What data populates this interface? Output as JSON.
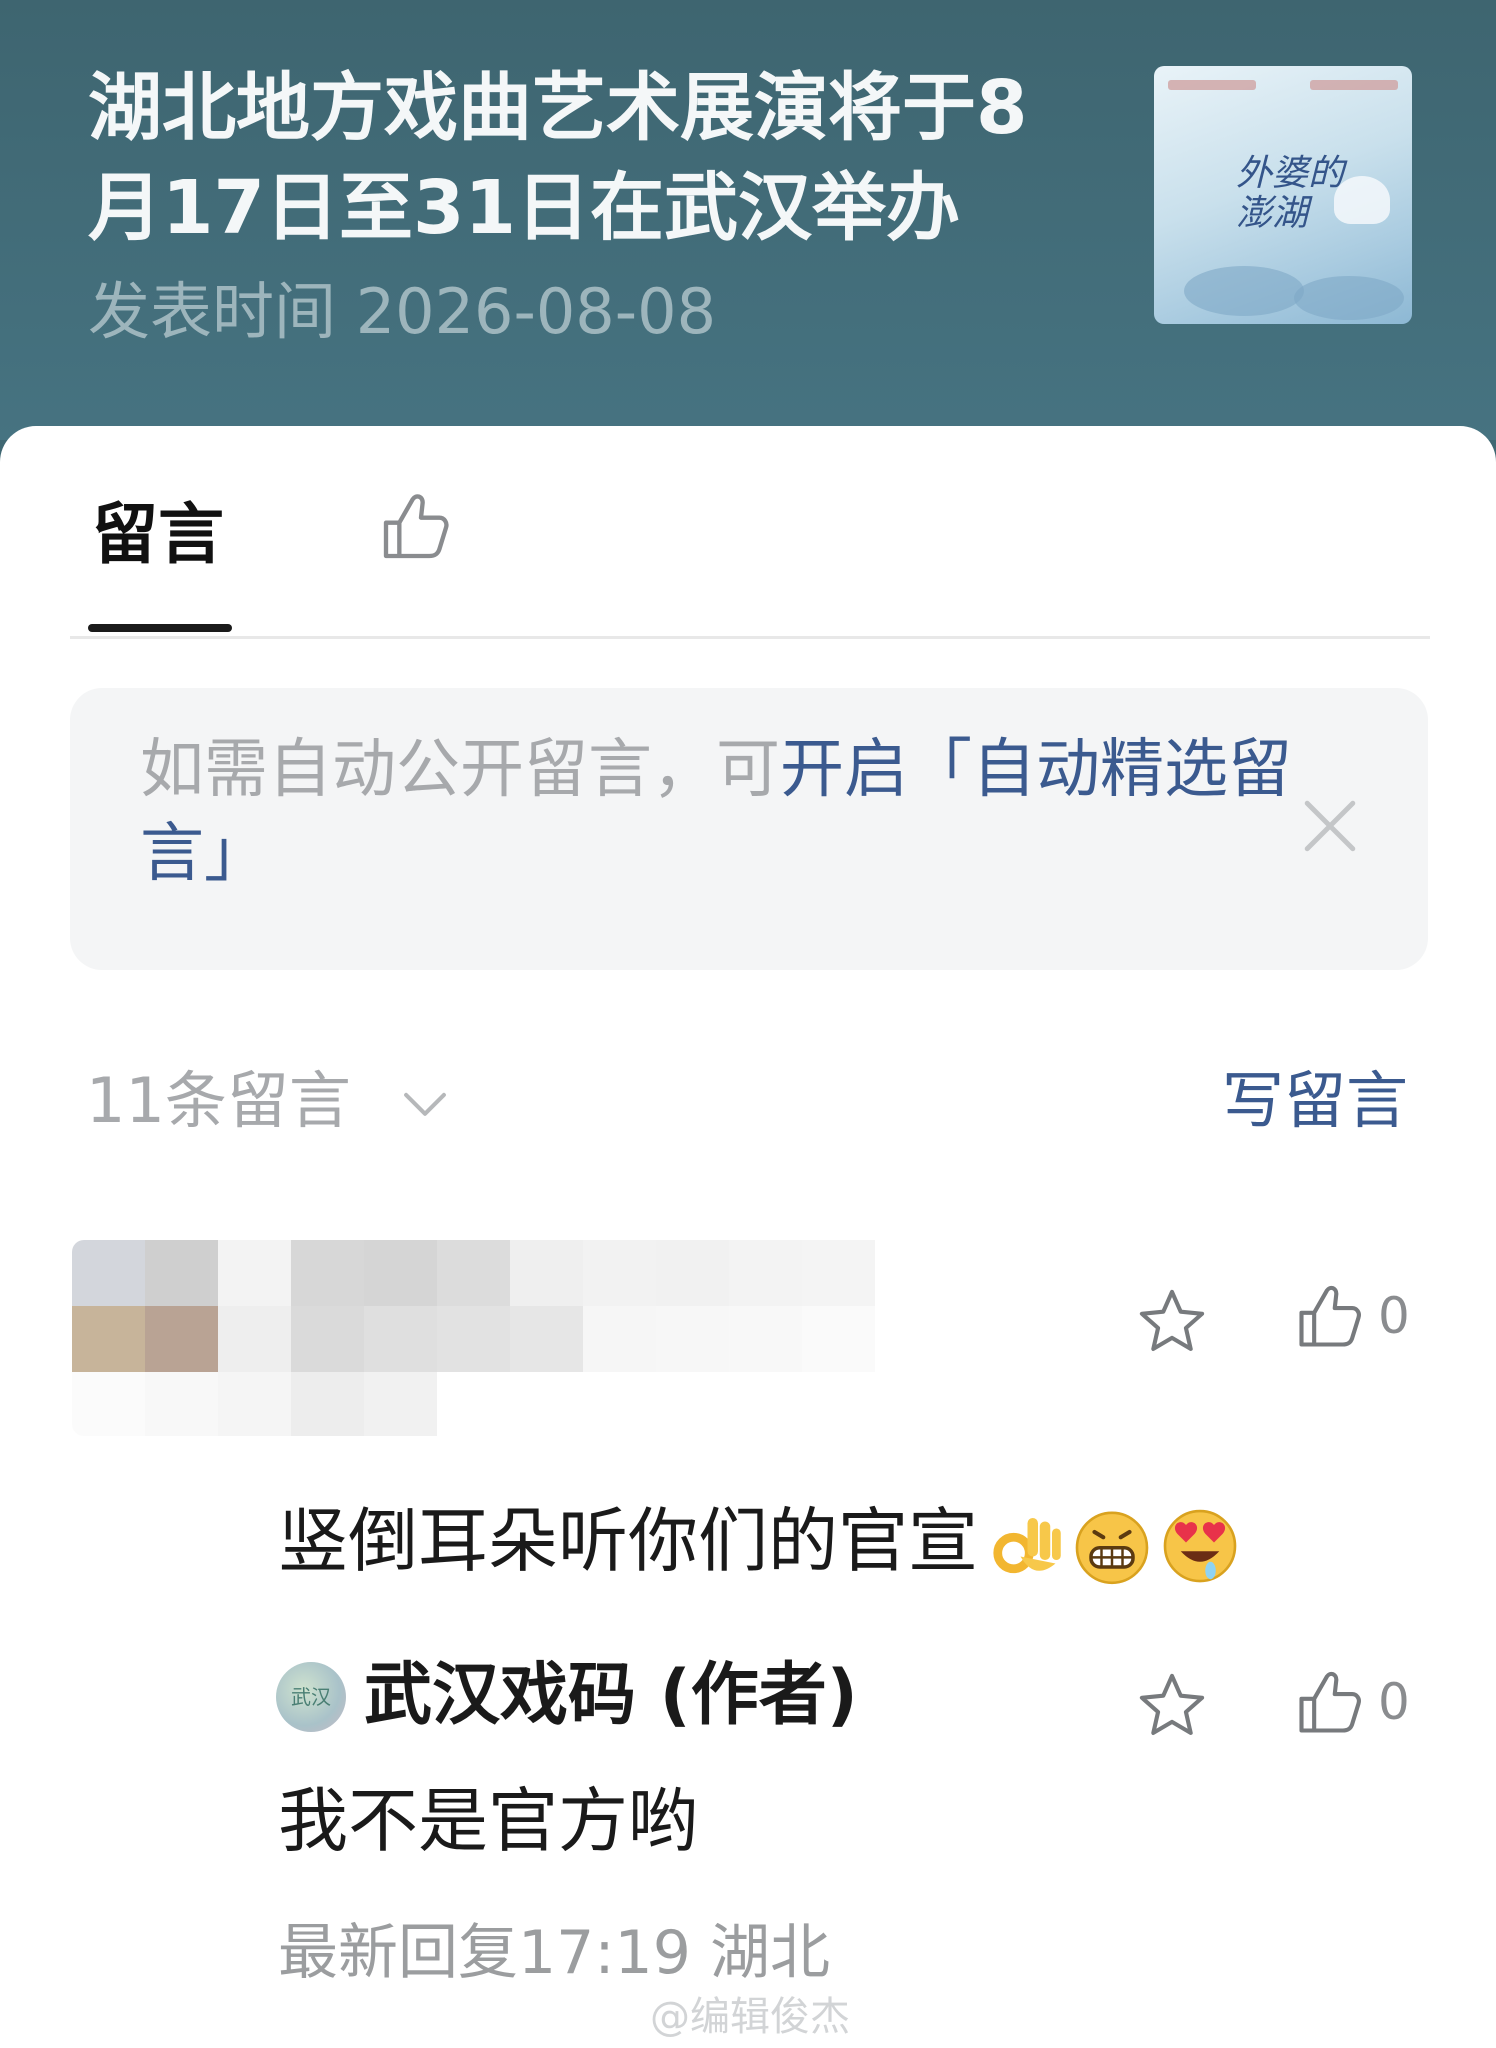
{
  "article": {
    "title": "湖北地方戏曲艺术展演将于8月17日至31日在武汉举办",
    "published": "发表时间 2026-08-08",
    "cover_caption": "外婆的澎湖"
  },
  "tabs": {
    "comments_label": "留言",
    "like_icon": "thumbs-up-icon"
  },
  "notice": {
    "text_plain": "如需自动公开留言，可",
    "text_link": "开启「自动精选留言」",
    "close_icon": "close-icon"
  },
  "comments_header": {
    "count_label": "11条留言",
    "write_label": "写留言"
  },
  "comments": [
    {
      "user_redacted": true,
      "text": "竖倒耳朵听你们的官宣",
      "emojis": [
        "ok-hand-emoji",
        "grinning-emoji",
        "heart-eyes-emoji"
      ],
      "like_count": "0",
      "reply": {
        "author": "武汉戏码 (作者)",
        "avatar_text": "武汉",
        "text": "我不是官方哟",
        "like_count": "0"
      },
      "meta": "最新回复17:19  湖北"
    }
  ],
  "watermark": "@编辑俊杰",
  "colors": {
    "header_bg": "#3f6772",
    "link_blue": "#3b5a8f",
    "muted_gray": "#a7a9ac"
  }
}
